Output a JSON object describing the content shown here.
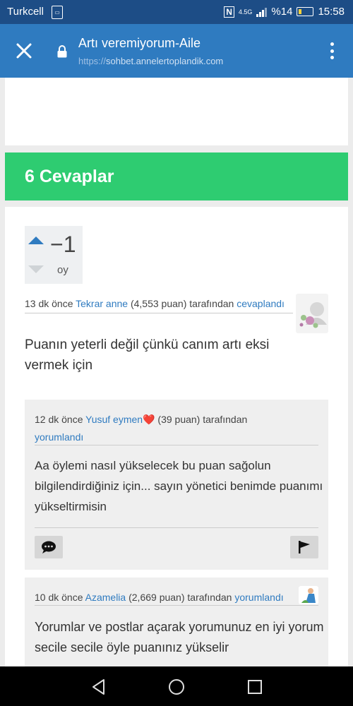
{
  "status_bar": {
    "carrier": "Turkcell",
    "network": "4.5G",
    "battery": "%14",
    "time": "15:58"
  },
  "app_bar": {
    "title": "Artı veremiyorum-Aile",
    "url_scheme": "https://",
    "url_host": "sohbet.annelertoplandik.com",
    "icons": [
      "close-icon",
      "lock-icon",
      "more-vert-icon"
    ]
  },
  "answers_header": {
    "label": "6 Cevaplar",
    "color": "#2ecc71"
  },
  "answer": {
    "vote_count": "−1",
    "vote_unit": "oy",
    "meta": {
      "time": "13 dk önce",
      "user": "Tekrar anne",
      "points": "(4,553 puan)",
      "by": "tarafından",
      "action": "cevaplandı"
    },
    "text": "Puanın yeterli değil çünkü canım artı eksi vermek için"
  },
  "comments": [
    {
      "time": "12 dk önce",
      "user": "Yusuf eymen",
      "heart": "❤️",
      "points": "(39 puan)",
      "by": "tarafından",
      "action": "yorumlandı",
      "text": "Aa öylemi nasıl yükselecek bu puan sağolun bilgilendirdiğiniz için... sayın  yönetici benimde puanımı yükseltirmisin"
    },
    {
      "time": "10 dk önce",
      "user": "Azamelia",
      "points": "(2,669 puan)",
      "by": "tarafından",
      "action": "yorumlandı",
      "text": "Yorumlar ve postlar açarak yorumunuz en iyi yorum secile secile öyle  puanınız yükselir"
    }
  ],
  "colors": {
    "accent": "#2f7bc0",
    "status_bar": "#1d4d86"
  }
}
